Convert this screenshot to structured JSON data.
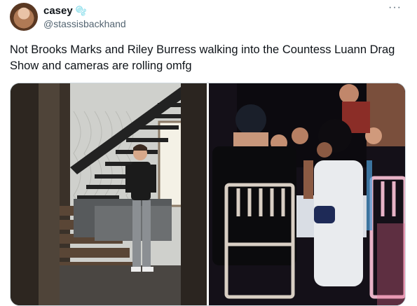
{
  "tweet": {
    "display_name": "casey",
    "name_emoji": "🫧",
    "handle": "@stassisbackhand",
    "more_glyph": "···",
    "text": "Not Brooks Marks and Riley Burress walking into the Countess Luann Drag Show and cameras are rolling omfg"
  },
  "icons": {
    "avatar": "profile-photo",
    "more": "more-options-icon"
  }
}
